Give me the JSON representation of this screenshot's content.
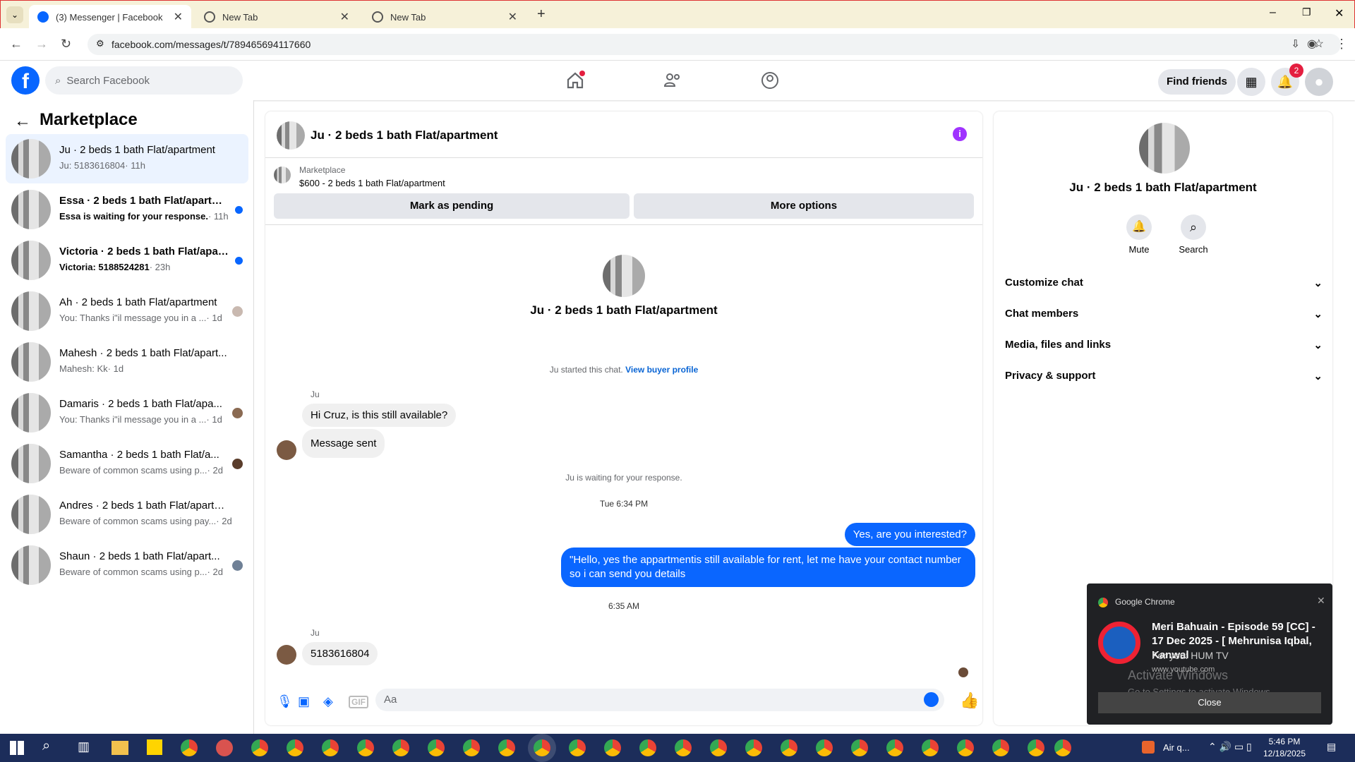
{
  "browser": {
    "tabs": [
      {
        "label": "(3) Messenger | Facebook"
      },
      {
        "label": "New Tab"
      },
      {
        "label": "New Tab"
      }
    ],
    "url": "facebook.com/messages/t/789465694117660"
  },
  "fb": {
    "search_placeholder": "Search Facebook",
    "find_friends": "Find friends",
    "notif_count": "2"
  },
  "sidebar": {
    "title": "Marketplace",
    "items": [
      {
        "title": "Ju · 2 beds 1 bath Flat/apartment",
        "sub": "Ju: 5183616804",
        "time": "· 11h"
      },
      {
        "title": "Essa · 2 beds 1 bath Flat/apartme...",
        "sub": "Essa is waiting for your response.",
        "time": "· 11h"
      },
      {
        "title": "Victoria · 2 beds 1 bath Flat/apar...",
        "sub": "Victoria: 5188524281",
        "time": "· 23h"
      },
      {
        "title": "Ah · 2 beds 1 bath Flat/apartment",
        "sub": "You: Thanks i\"il message you in a ...",
        "time": "· 1d"
      },
      {
        "title": "Mahesh · 2 beds 1 bath Flat/apart...",
        "sub": "Mahesh: Kk",
        "time": "· 1d"
      },
      {
        "title": "Damaris · 2 beds 1 bath Flat/apa...",
        "sub": "You: Thanks i\"il message you in a ...",
        "time": "· 1d"
      },
      {
        "title": "Samantha · 2 beds 1 bath Flat/a...",
        "sub": "Beware of common scams using p...",
        "time": "· 2d"
      },
      {
        "title": "Andres · 2 beds 1 bath Flat/apartm...",
        "sub": "Beware of common scams using pay...",
        "time": "· 2d"
      },
      {
        "title": "Shaun · 2 beds 1 bath Flat/apart...",
        "sub": "Beware of common scams using p...",
        "time": "· 2d"
      }
    ]
  },
  "chat": {
    "title": "Ju · 2 beds 1 bath Flat/apartment",
    "listing_label": "Marketplace",
    "listing": "$600 - 2 beds 1 bath Flat/apartment",
    "btn_pending": "Mark as pending",
    "btn_more": "More options",
    "center_name": "Ju · 2 beds 1 bath Flat/apartment",
    "started": "Ju started this chat.",
    "view_profile": "View buyer profile",
    "sender1": "Ju",
    "msg1": "Hi Cruz, is this still available?",
    "msg2": "Message sent",
    "waiting": "Ju is waiting for your response.",
    "time1": "Tue 6:34 PM",
    "out1": "Yes, are you interested?",
    "out2": "\"Hello, yes the appartmentis still available for rent, let me have your contact number so i can send you details",
    "time2": "6:35 AM",
    "sender2": "Ju",
    "msg3": "5183616804",
    "input_placeholder": "Aa"
  },
  "right": {
    "name": "Ju · 2 beds 1 bath Flat/apartment",
    "mute": "Mute",
    "search": "Search",
    "sections": [
      "Customize chat",
      "Chat members",
      "Media, files and links",
      "Privacy & support"
    ]
  },
  "notification": {
    "app": "Google Chrome",
    "title": "Meri Bahuain - Episode 59 [CC] - 17 Dec 2025 - [ Mehrunisa Iqbal, Kanwal",
    "sub": "For you: HUM TV",
    "site": "www.youtube.com",
    "close": "Close",
    "watermark1": "Activate Windows",
    "watermark2": "Go to Settings to activate Windows."
  },
  "taskbar": {
    "weather": "Air q...",
    "time": "5:46 PM",
    "date": "12/18/2025"
  }
}
